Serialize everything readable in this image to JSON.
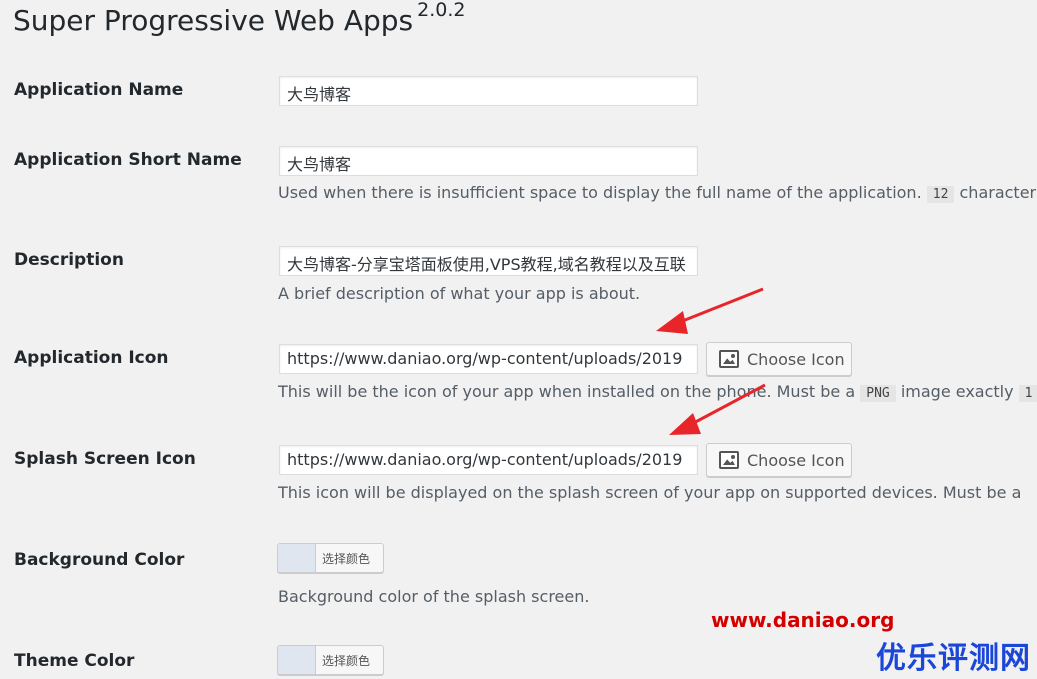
{
  "page": {
    "title": "Super Progressive Web Apps",
    "version": "2.0.2"
  },
  "fields": {
    "app_name": {
      "label": "Application Name",
      "value": "大鸟博客"
    },
    "app_short_name": {
      "label": "Application Short Name",
      "value": "大鸟博客",
      "help_prefix": "Used when there is insufficient space to display the full name of the application.",
      "help_code": "12",
      "help_suffix": "character"
    },
    "description": {
      "label": "Description",
      "value": "大鸟博客-分享宝塔面板使用,VPS教程,域名教程以及互联",
      "help": "A brief description of what your app is about."
    },
    "app_icon": {
      "label": "Application Icon",
      "value": "https://www.daniao.org/wp-content/uploads/2019",
      "button_label": "Choose Icon",
      "help_prefix": "This will be the icon of your app when installed on the phone. Must be a",
      "help_code": "PNG",
      "help_suffix": "image exactly",
      "help_cut": "1"
    },
    "splash_icon": {
      "label": "Splash Screen Icon",
      "value": "https://www.daniao.org/wp-content/uploads/2019",
      "button_label": "Choose Icon",
      "help": "This icon will be displayed on the splash screen of your app on supported devices. Must be a"
    },
    "background_color": {
      "label": "Background Color",
      "button_label": "选择颜色",
      "swatch_color": "#dfe6ef",
      "help": "Background color of the splash screen."
    },
    "theme_color": {
      "label": "Theme Color",
      "button_label": "选择颜色",
      "swatch_color": "#dfe6ef"
    }
  },
  "watermark": {
    "url": "www.daniao.org",
    "site": "优乐评测网",
    "url_color": "#d40000",
    "site_color": "#1b47d8"
  },
  "annotation": {
    "arrow_color": "#e8262a"
  }
}
